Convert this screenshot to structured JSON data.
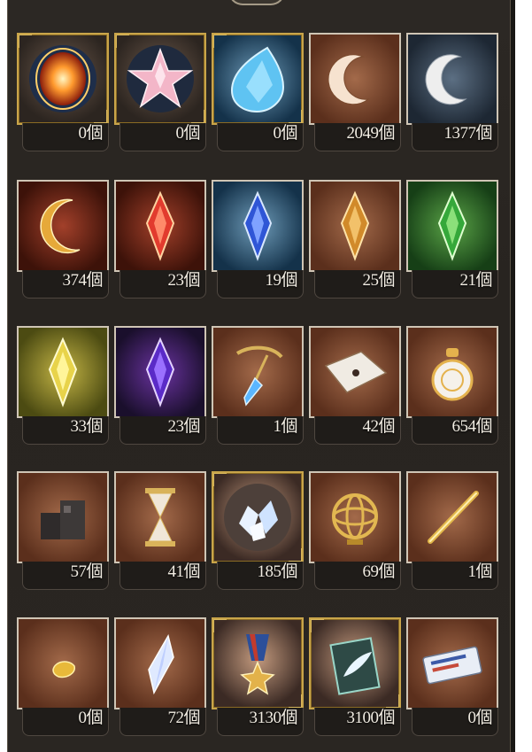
{
  "inventory": {
    "items": [
      {
        "icon": "sun-orb-icon",
        "count": "0個"
      },
      {
        "icon": "pink-star-crystal-icon",
        "count": "0個"
      },
      {
        "icon": "blue-teardrop-gem-icon",
        "count": "0個"
      },
      {
        "icon": "silver-crescent-icon",
        "count": "2049個"
      },
      {
        "icon": "white-crescent-icon",
        "count": "1377個"
      },
      {
        "icon": "gold-crescent-icon",
        "count": "374個"
      },
      {
        "icon": "fire-crystal-icon",
        "count": "23個"
      },
      {
        "icon": "water-crystal-icon",
        "count": "19個"
      },
      {
        "icon": "earth-crystal-icon",
        "count": "25個"
      },
      {
        "icon": "wind-crystal-icon",
        "count": "21個"
      },
      {
        "icon": "light-crystal-icon",
        "count": "33個"
      },
      {
        "icon": "dark-crystal-icon",
        "count": "23個"
      },
      {
        "icon": "pendulum-icon",
        "count": "1個"
      },
      {
        "icon": "map-scroll-icon",
        "count": "42個"
      },
      {
        "icon": "perfume-bottle-icon",
        "count": "654個"
      },
      {
        "icon": "stone-blocks-icon",
        "count": "57個"
      },
      {
        "icon": "hourglass-icon",
        "count": "41個"
      },
      {
        "icon": "crystal-cluster-icon",
        "count": "185個"
      },
      {
        "icon": "armillary-sphere-icon",
        "count": "69個"
      },
      {
        "icon": "golden-quill-icon",
        "count": "1個"
      },
      {
        "icon": "gold-nugget-icon",
        "count": "0個"
      },
      {
        "icon": "prism-shard-icon",
        "count": "72個"
      },
      {
        "icon": "medal-icon",
        "count": "3130個"
      },
      {
        "icon": "feather-certificate-icon",
        "count": "3100個"
      },
      {
        "icon": "ticket-icon",
        "count": "0個"
      }
    ]
  }
}
